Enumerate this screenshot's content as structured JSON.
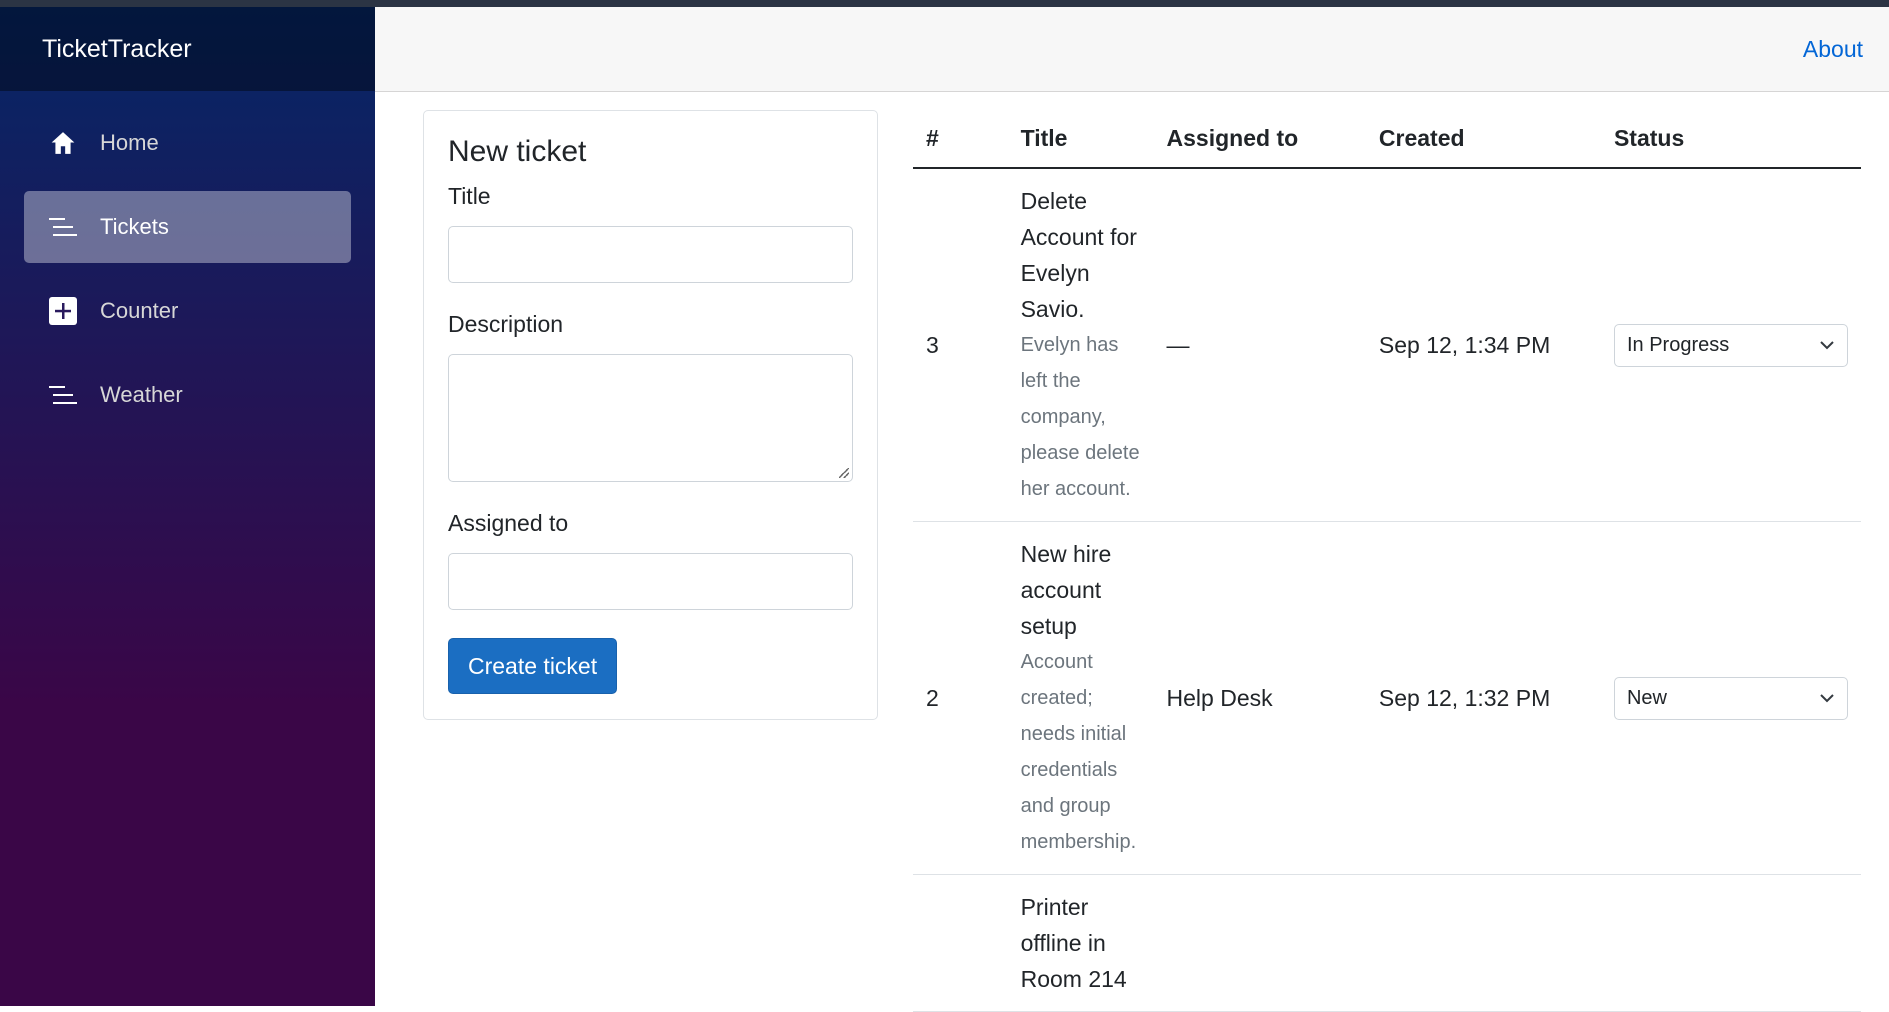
{
  "app": {
    "brand": "TicketTracker",
    "about_link": "About"
  },
  "sidebar": {
    "items": [
      {
        "label": "Home",
        "icon": "home-icon",
        "active": false
      },
      {
        "label": "Tickets",
        "icon": "list-icon",
        "active": true
      },
      {
        "label": "Counter",
        "icon": "plus-square-icon",
        "active": false
      },
      {
        "label": "Weather",
        "icon": "list-icon",
        "active": false
      }
    ]
  },
  "form": {
    "heading": "New ticket",
    "title_label": "Title",
    "title_value": "",
    "description_label": "Description",
    "description_value": "",
    "assigned_label": "Assigned to",
    "assigned_value": "",
    "submit_label": "Create ticket"
  },
  "table": {
    "headers": [
      "#",
      "Title",
      "Assigned to",
      "Created",
      "Status"
    ],
    "rows": [
      {
        "id": "3",
        "title": "Delete Account for Evelyn Savio.",
        "description": "Evelyn has left the company, please delete her account.",
        "assigned": "—",
        "created": "Sep 12, 1:34 PM",
        "status": "In Progress"
      },
      {
        "id": "2",
        "title": "New hire account setup",
        "description": "Account created; needs initial credentials and group membership.",
        "assigned": "Help Desk",
        "created": "Sep 12, 1:32 PM",
        "status": "New"
      },
      {
        "id": "",
        "title": "Printer offline in Room 214",
        "description": "",
        "assigned": "",
        "created": "",
        "status": ""
      }
    ]
  },
  "colors": {
    "accent": "#1b6ec2",
    "link": "#0366d6",
    "sidebar_top": "#052767",
    "sidebar_bottom": "#3a0647"
  }
}
